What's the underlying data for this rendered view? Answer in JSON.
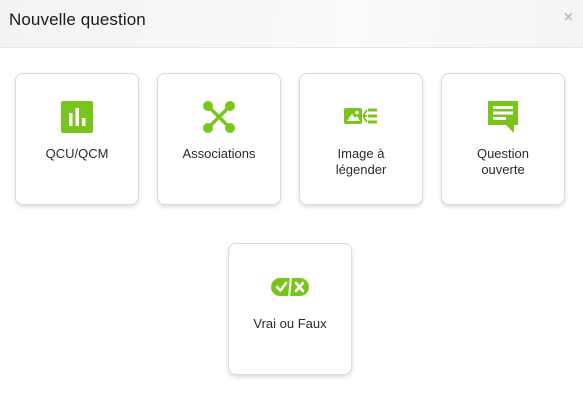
{
  "dialog": {
    "title": "Nouvelle question",
    "close_label": "×"
  },
  "accent_color": "#79c51c",
  "question_types": [
    {
      "label": "QCU/QCM",
      "icon": "bar-chart-icon"
    },
    {
      "label": "Associations",
      "icon": "connections-icon"
    },
    {
      "label": "Image à\nlégender",
      "icon": "image-caption-icon"
    },
    {
      "label": "Question\nouverte",
      "icon": "text-bubble-icon"
    },
    {
      "label": "Vrai ou Faux",
      "icon": "true-false-icon"
    }
  ]
}
